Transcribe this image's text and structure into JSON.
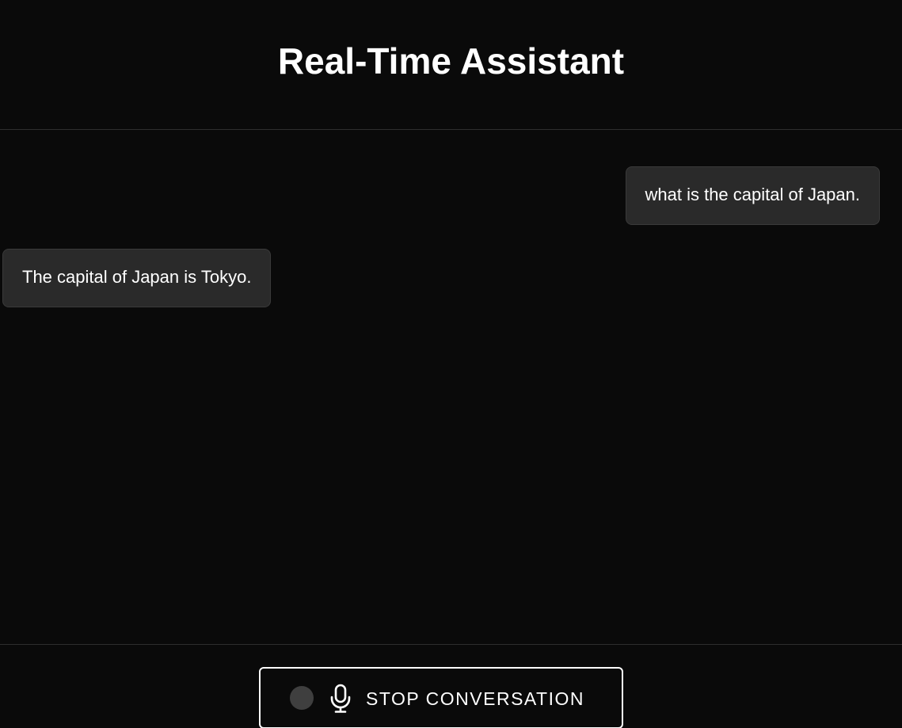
{
  "header": {
    "title": "Real-Time Assistant"
  },
  "messages": [
    {
      "role": "user",
      "text": "what is the capital of Japan."
    },
    {
      "role": "assistant",
      "text": "The capital of Japan is Tokyo."
    }
  ],
  "controls": {
    "stop_label": "STOP CONVERSATION",
    "status_indicator": "inactive",
    "mic_icon": "microphone-icon"
  },
  "colors": {
    "background": "#0a0a0a",
    "bubble": "#2a2a2a",
    "text": "#ffffff",
    "status_dot": "#3f3f3f"
  }
}
